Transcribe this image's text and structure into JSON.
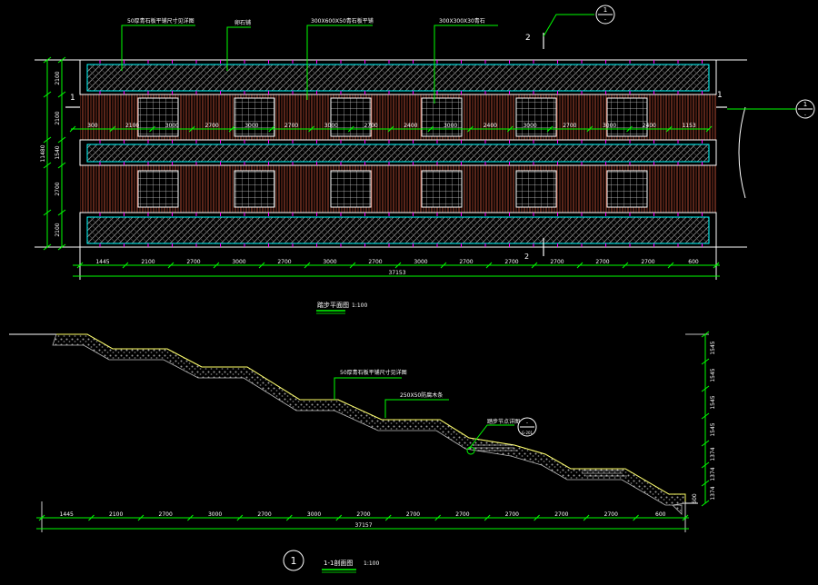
{
  "colors": {
    "background": "#000000",
    "outline": "#ffffff",
    "dimension": "#00ff00",
    "cyan": "#00ffff",
    "wood": "#ff6a4a",
    "magenta": "#ff00ff",
    "yellow": "#ffff66",
    "label": "#ffff00"
  },
  "plan": {
    "callouts": [
      "50厚青石板平铺尺寸见详图",
      "卵石铺",
      "300X600X50青石板平铺",
      "300X300X30青石"
    ],
    "section_marker": {
      "top": "1",
      "bottom": "-"
    },
    "cut_labels": {
      "left_top": "1",
      "right_top": "1",
      "top": "2",
      "bottom": "2"
    },
    "row_dims": [
      "300",
      "2100",
      "3000",
      "2700",
      "3000",
      "2700",
      "3000",
      "2700",
      "2400",
      "3000",
      "2400",
      "3000",
      "2700",
      "3000",
      "2400",
      "1153"
    ],
    "left_dims": [
      "2100",
      "2100",
      "1540",
      "2700",
      "2100"
    ],
    "left_total": "11480",
    "bottom_dims": [
      "1445",
      "2100",
      "2700",
      "3000",
      "2700",
      "3000",
      "2700",
      "3000",
      "2700",
      "2700",
      "2700",
      "2700",
      "2700",
      "600"
    ],
    "bottom_total": "37153",
    "title": "踏步平面图",
    "scale": "1:100"
  },
  "section": {
    "callouts": [
      "50厚青石板平铺尺寸见详图",
      "250X50防腐木条",
      "踏步节点详图"
    ],
    "detail_marker": {
      "top": "-",
      "bottom": "G-201"
    },
    "right_dims": [
      "1545",
      "1545",
      "1545",
      "1545",
      "1374",
      "1374",
      "1374"
    ],
    "base_dim": "600",
    "bottom_dims": [
      "1445",
      "2100",
      "2700",
      "3000",
      "2700",
      "3000",
      "2700",
      "2700",
      "2700",
      "2700",
      "2700",
      "2700",
      "600"
    ],
    "bottom_total": "37157",
    "title_number": "1",
    "title": "1-1剖面图",
    "scale": "1:100"
  }
}
